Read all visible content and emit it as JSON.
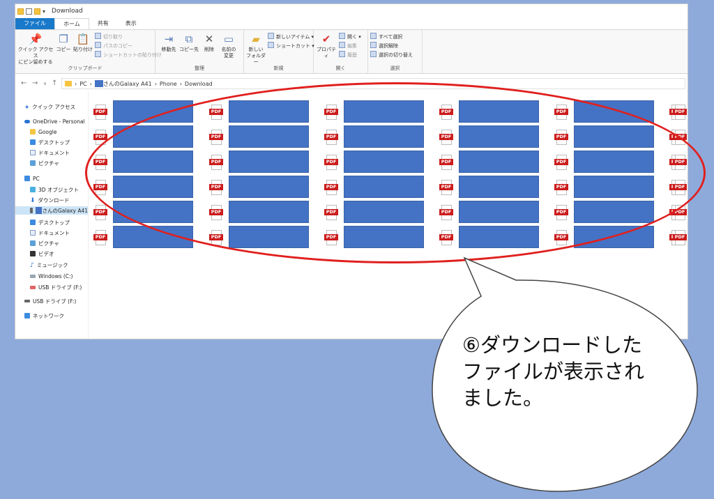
{
  "window": {
    "title": "Download",
    "quick_access_drop": "▾"
  },
  "tabs": [
    {
      "label": "ファイル"
    },
    {
      "label": "ホーム"
    },
    {
      "label": "共有"
    },
    {
      "label": "表示"
    }
  ],
  "ribbon": {
    "clipboard": {
      "group_label": "クリップボード",
      "pin_label_1": "クイック アクセス",
      "pin_label_2": "にピン留めする",
      "copy_label": "コピー",
      "paste_label": "貼り付け",
      "cut_label": "切り取り",
      "copy_path_label": "パスのコピー",
      "paste_shortcut_label": "ショートカットの貼り付け"
    },
    "organize": {
      "group_label": "整理",
      "move_label": "移動先",
      "copy_to_label": "コピー先",
      "delete_label": "削除",
      "rename_label_1": "名前の",
      "rename_label_2": "変更"
    },
    "new": {
      "group_label": "新規",
      "new_folder_label_1": "新しい",
      "new_folder_label_2": "フォルダー",
      "new_item_label": "新しいアイテム",
      "shortcut_label": "ショートカット"
    },
    "open": {
      "group_label": "開く",
      "properties_label": "プロパティ",
      "open_label": "開く",
      "edit_label": "編集",
      "history_label": "履歴"
    },
    "select": {
      "group_label": "選択",
      "select_all_label": "すべて選択",
      "select_none_label": "選択解除",
      "invert_label": "選択の切り替え"
    }
  },
  "address": {
    "pc": "PC",
    "device": "さんのGalaxy A41",
    "phone": "Phone",
    "download": "Download"
  },
  "nav_pane": [
    {
      "label": "クイック アクセス"
    },
    {
      "label": "OneDrive - Personal"
    },
    {
      "label": "Google"
    },
    {
      "label": "デスクトップ"
    },
    {
      "label": "ドキュメント"
    },
    {
      "label": "ピクチャ"
    },
    {
      "label": "PC"
    },
    {
      "label": "3D オブジェクト"
    },
    {
      "label": "ダウンロード"
    },
    {
      "label": "さんのGalaxy A41"
    },
    {
      "label": "デスクトップ"
    },
    {
      "label": "ドキュメント"
    },
    {
      "label": "ピクチャ"
    },
    {
      "label": "ビデオ"
    },
    {
      "label": "ミュージック"
    },
    {
      "label": "Windows (C:)"
    },
    {
      "label": "USB ドライブ (F:)"
    },
    {
      "label": "USB ドライブ (F:)"
    },
    {
      "label": "ネットワーク"
    }
  ],
  "files": {
    "pdf_badge": "PDF"
  },
  "callout": {
    "line1": "⑥ダウンロードした",
    "line2": "ファイルが表示され",
    "line3": "ました。"
  },
  "colors": {
    "redaction": "#4472c4",
    "highlight": "#e0201e",
    "background": "#8eaadb"
  }
}
